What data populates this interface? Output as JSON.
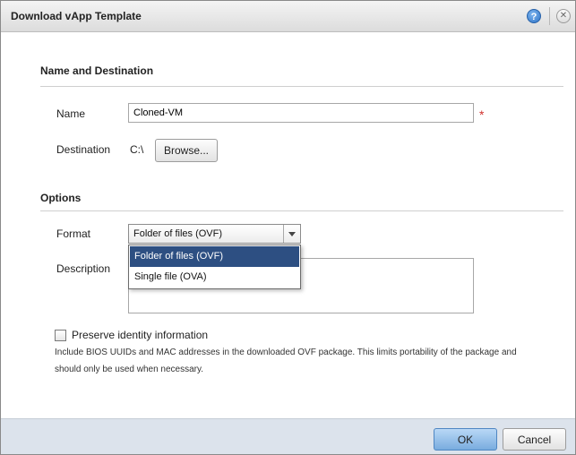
{
  "dialog": {
    "title": "Download vApp Template",
    "help_icon": "help-icon",
    "close_icon": "close-icon"
  },
  "name_section": {
    "title": "Name and Destination",
    "name_label": "Name",
    "name_value": "Cloned-VM",
    "required_mark": "*",
    "destination_label": "Destination",
    "destination_value": "C:\\",
    "browse_label": "Browse..."
  },
  "options_section": {
    "title": "Options",
    "format_label": "Format",
    "format_selected": "Folder of files (OVF)",
    "format_options": [
      "Folder of files (OVF)",
      "Single file (OVA)"
    ],
    "description_label": "Description",
    "description_value": ""
  },
  "preserve": {
    "label": "Preserve identity information",
    "checked": false,
    "help_text": "Include BIOS UUIDs and MAC addresses in the downloaded OVF package. This limits portability of the package and should only be used when necessary."
  },
  "footer": {
    "ok_label": "OK",
    "cancel_label": "Cancel"
  }
}
